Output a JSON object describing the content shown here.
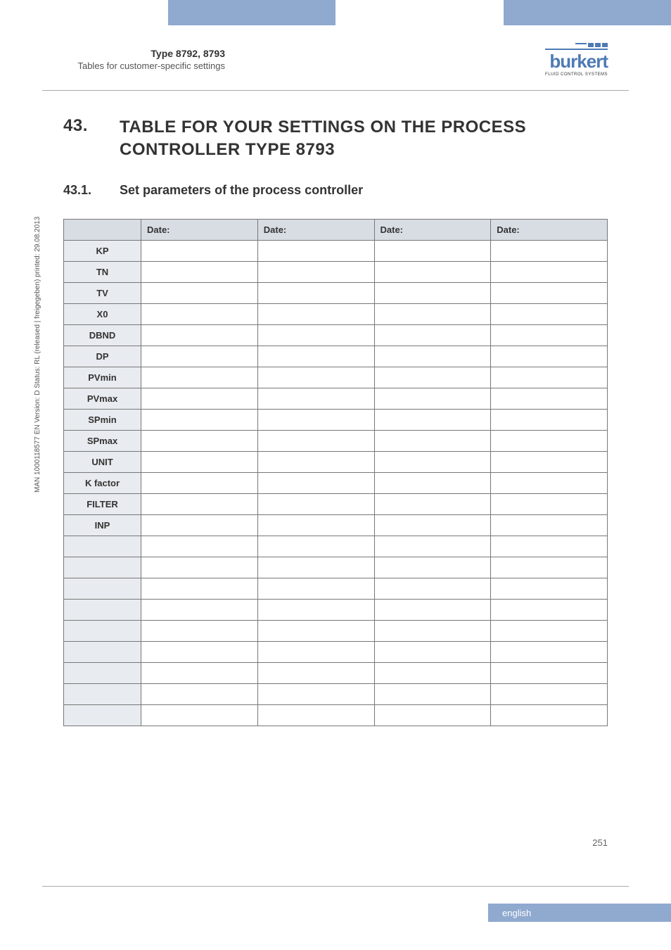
{
  "header": {
    "type_line": "Type 8792, 8793",
    "sub_line": "Tables for customer-specific settings",
    "logo_text": "burkert",
    "logo_sub": "FLUID CONTROL SYSTEMS"
  },
  "side_text": "MAN  1000118577  EN  Version: D  Status: RL (released | freigegeben)  printed: 29.08.2013",
  "heading1": {
    "num": "43.",
    "text": "TABLE FOR YOUR SETTINGS ON THE PROCESS CONTROLLER TYPE 8793"
  },
  "heading2": {
    "num": "43.1.",
    "text": "Set parameters of the process controller"
  },
  "chart_data": {
    "type": "table",
    "title": "Set parameters of the process controller",
    "columns": [
      "",
      "Date:",
      "Date:",
      "Date:",
      "Date:"
    ],
    "rows": [
      {
        "label": "KP",
        "values": [
          "",
          "",
          "",
          ""
        ]
      },
      {
        "label": "TN",
        "values": [
          "",
          "",
          "",
          ""
        ]
      },
      {
        "label": "TV",
        "values": [
          "",
          "",
          "",
          ""
        ]
      },
      {
        "label": "X0",
        "values": [
          "",
          "",
          "",
          ""
        ]
      },
      {
        "label": "DBND",
        "values": [
          "",
          "",
          "",
          ""
        ]
      },
      {
        "label": "DP",
        "values": [
          "",
          "",
          "",
          ""
        ]
      },
      {
        "label": "PVmin",
        "values": [
          "",
          "",
          "",
          ""
        ]
      },
      {
        "label": "PVmax",
        "values": [
          "",
          "",
          "",
          ""
        ]
      },
      {
        "label": "SPmin",
        "values": [
          "",
          "",
          "",
          ""
        ]
      },
      {
        "label": "SPmax",
        "values": [
          "",
          "",
          "",
          ""
        ]
      },
      {
        "label": "UNIT",
        "values": [
          "",
          "",
          "",
          ""
        ]
      },
      {
        "label": "K factor",
        "values": [
          "",
          "",
          "",
          ""
        ]
      },
      {
        "label": "FILTER",
        "values": [
          "",
          "",
          "",
          ""
        ]
      },
      {
        "label": "INP",
        "values": [
          "",
          "",
          "",
          ""
        ]
      },
      {
        "label": "",
        "values": [
          "",
          "",
          "",
          ""
        ]
      },
      {
        "label": "",
        "values": [
          "",
          "",
          "",
          ""
        ]
      },
      {
        "label": "",
        "values": [
          "",
          "",
          "",
          ""
        ]
      },
      {
        "label": "",
        "values": [
          "",
          "",
          "",
          ""
        ]
      },
      {
        "label": "",
        "values": [
          "",
          "",
          "",
          ""
        ]
      },
      {
        "label": "",
        "values": [
          "",
          "",
          "",
          ""
        ]
      },
      {
        "label": "",
        "values": [
          "",
          "",
          "",
          ""
        ]
      },
      {
        "label": "",
        "values": [
          "",
          "",
          "",
          ""
        ]
      },
      {
        "label": "",
        "values": [
          "",
          "",
          "",
          ""
        ]
      }
    ]
  },
  "page_number": "251",
  "footer_lang": "english"
}
